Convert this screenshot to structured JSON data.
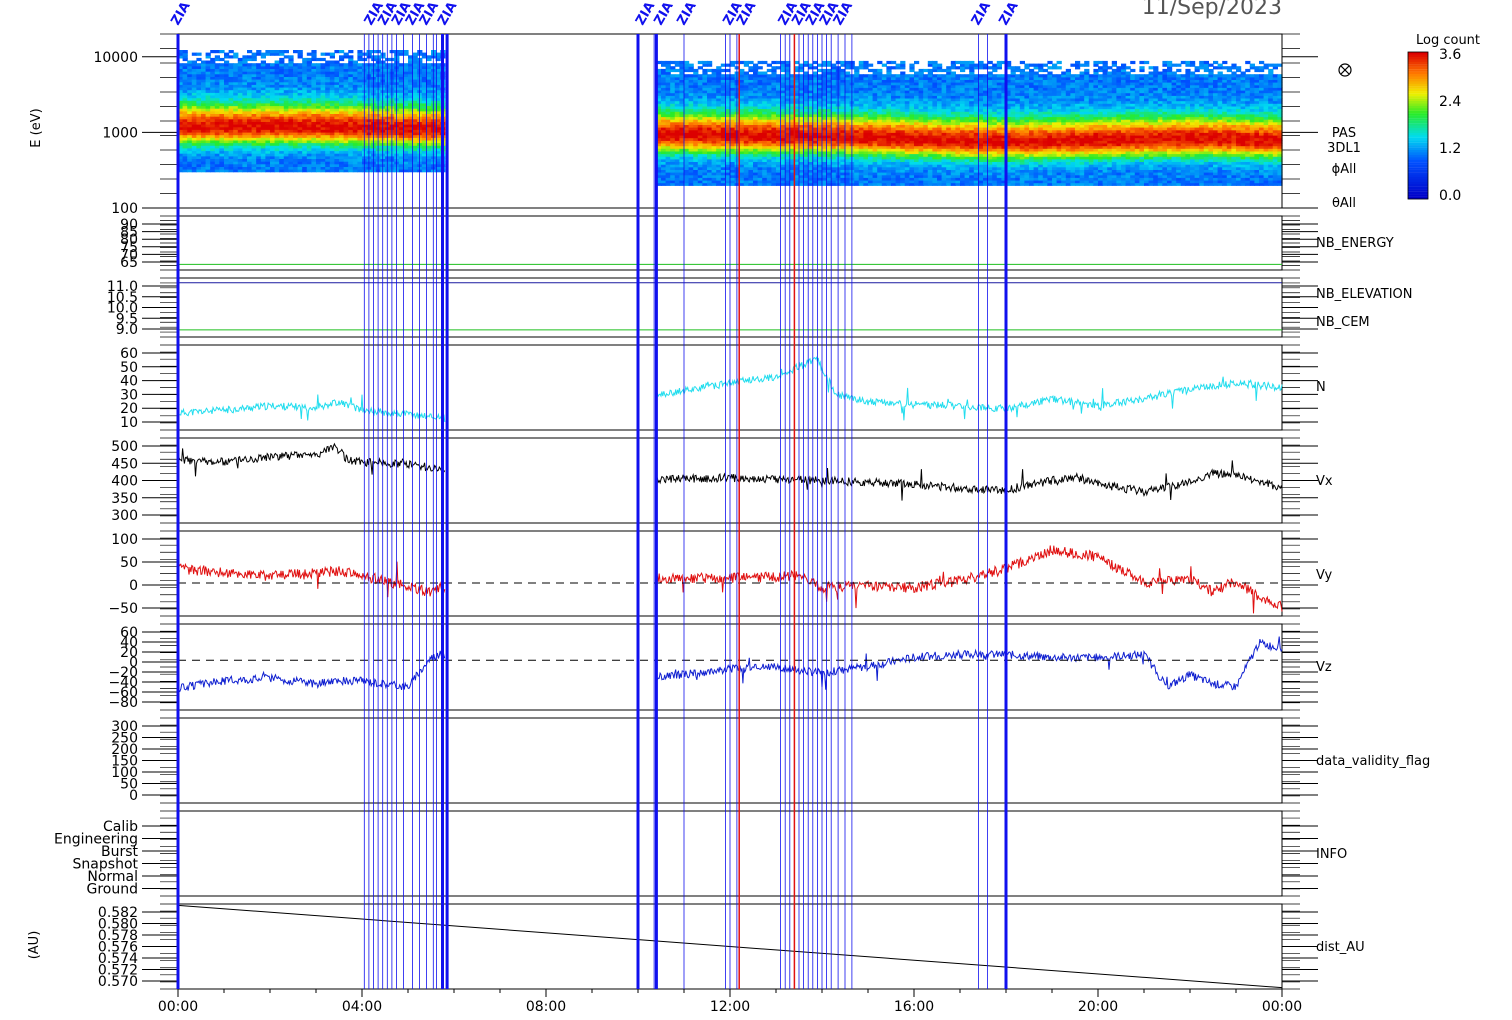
{
  "date_title": "11/Sep/2023",
  "colorbar": {
    "title": "Log count",
    "ticks": [
      "3.6",
      "2.4",
      "1.2",
      "0.0"
    ]
  },
  "marker_label": "ZIA",
  "x_ticks": [
    "00:00",
    "04:00",
    "08:00",
    "12:00",
    "16:00",
    "20:00",
    "00:00"
  ],
  "colors": {
    "nb_energy": "#1fbf1f",
    "nb_elevation": "#1fbf1f",
    "nb_cem": "#1a1aa0",
    "n": "#22ddee",
    "vx": "#000000",
    "vy": "#e01010",
    "vz": "#1020d0",
    "event_blue": "#1010ee",
    "event_red": "#e01010"
  },
  "panels": {
    "energy": {
      "ylabel": "E (eV)",
      "ticks": [
        "10000",
        "1000",
        "100"
      ],
      "right": [
        "PAS",
        "3DL1",
        "ϕAll",
        "θAll"
      ],
      "symbol_icon": "circled-times-icon"
    },
    "nb_energy": {
      "ticks": [
        "90",
        "85",
        "80",
        "75",
        "70",
        "65"
      ],
      "label": "NB_ENERGY"
    },
    "nb_elev": {
      "ticks": [
        "11.0",
        "10.5",
        "10.0",
        "9.5",
        "9.0"
      ],
      "label1": "NB_ELEVATION",
      "label2": "NB_CEM"
    },
    "n": {
      "ticks": [
        "60",
        "50",
        "40",
        "30",
        "20",
        "10"
      ],
      "label": "N"
    },
    "vx": {
      "ticks": [
        "500",
        "450",
        "400",
        "350",
        "300"
      ],
      "label": "Vx"
    },
    "vy": {
      "ticks": [
        "100",
        "50",
        "0",
        "−50"
      ],
      "label": "Vy"
    },
    "vz": {
      "ticks": [
        "60",
        "40",
        "20",
        "0",
        "−20",
        "−40",
        "−60",
        "−80"
      ],
      "label": "Vz"
    },
    "flag": {
      "ticks": [
        "300",
        "250",
        "200",
        "150",
        "100",
        "50",
        "0"
      ],
      "label": "data_validity_flag"
    },
    "info": {
      "ticks": [
        "Calib",
        "Engineering",
        "Burst",
        "Snapshot",
        "Normal",
        "Ground"
      ],
      "label": "INFO"
    },
    "dist": {
      "ylabel": "(AU)",
      "ticks": [
        "0.582",
        "0.580",
        "0.578",
        "0.576",
        "0.574",
        "0.572",
        "0.570"
      ],
      "label": "dist_AU"
    }
  },
  "chart_data": [
    {
      "type": "heatmap",
      "title": "PAS 3DL1",
      "ylabel": "E (eV)",
      "yscale": "log",
      "ylim": [
        100,
        20000
      ],
      "xlim": [
        0,
        24
      ],
      "colorbar_range": [
        0.0,
        3.6
      ],
      "data_gap_hours": [
        5.8,
        10.4
      ],
      "peak_energy_ev": [
        [
          0,
          1150
        ],
        [
          3,
          1150
        ],
        [
          5.7,
          1050
        ],
        [
          10.4,
          900
        ],
        [
          14,
          850
        ],
        [
          18,
          720
        ],
        [
          22,
          800
        ],
        [
          24,
          750
        ]
      ]
    },
    {
      "type": "line",
      "name": "NB_ENERGY",
      "ylim": [
        63,
        92
      ],
      "x": [
        0,
        24
      ],
      "y": [
        66,
        66
      ]
    },
    {
      "type": "line",
      "series": [
        {
          "name": "NB_ELEVATION",
          "x": [
            0,
            24
          ],
          "y": [
            9.0,
            9.0
          ]
        },
        {
          "name": "NB_CEM",
          "x": [
            0,
            24
          ],
          "y": [
            11.0,
            11.0
          ]
        }
      ],
      "ylim": [
        8.7,
        11.2
      ]
    },
    {
      "type": "line",
      "name": "N",
      "ylim": [
        0,
        60
      ],
      "x": [
        0,
        1,
        2,
        3,
        3.5,
        4,
        5,
        5.7,
        10.4,
        11,
        12,
        12.5,
        13,
        13.5,
        13.9,
        14.3,
        15,
        16,
        17,
        18,
        19,
        20,
        21,
        22,
        23,
        24
      ],
      "y": [
        12,
        14,
        17,
        16,
        20,
        14,
        11,
        9,
        24,
        28,
        33,
        36,
        37,
        45,
        50,
        25,
        20,
        18,
        17,
        15,
        22,
        17,
        22,
        29,
        33,
        30
      ]
    },
    {
      "type": "line",
      "name": "Vx",
      "ylim": [
        290,
        520
      ],
      "x": [
        0,
        1,
        2,
        3,
        3.4,
        3.7,
        4,
        5,
        5.7,
        10.4,
        12,
        14,
        16,
        17,
        18,
        19,
        19.5,
        20,
        21,
        22,
        22.5,
        23,
        24
      ],
      "y": [
        460,
        455,
        470,
        475,
        500,
        460,
        455,
        450,
        435,
        408,
        412,
        405,
        395,
        385,
        378,
        405,
        415,
        395,
        375,
        400,
        425,
        420,
        385
      ]
    },
    {
      "type": "line",
      "name": "Vy",
      "ylim": [
        -70,
        110
      ],
      "x": [
        0,
        2,
        3.5,
        4.5,
        5.5,
        5.7,
        10.4,
        12,
        13.5,
        14,
        15,
        16,
        17,
        18,
        19,
        20,
        21,
        22,
        22.5,
        23,
        23.5,
        24
      ],
      "y": [
        30,
        15,
        25,
        5,
        -20,
        -10,
        10,
        10,
        15,
        -10,
        -5,
        -10,
        5,
        30,
        70,
        55,
        0,
        10,
        -20,
        5,
        -30,
        -50
      ]
    },
    {
      "type": "line",
      "name": "Vz",
      "ylim": [
        -85,
        62
      ],
      "x": [
        0,
        1,
        2,
        3,
        3.5,
        4,
        5,
        5.5,
        5.7,
        10.4,
        12,
        13,
        14,
        15,
        16,
        17,
        18,
        19,
        20,
        21,
        21.5,
        22,
        22.5,
        23,
        23.5,
        24
      ],
      "y": [
        -48,
        -35,
        -30,
        -40,
        -35,
        -35,
        -45,
        5,
        10,
        -30,
        -15,
        -12,
        -22,
        -10,
        5,
        10,
        10,
        5,
        5,
        10,
        -45,
        -25,
        -40,
        -45,
        30,
        20
      ]
    },
    {
      "type": "line",
      "name": "data_validity_flag",
      "ylim": [
        0,
        310
      ],
      "x": [],
      "y": []
    },
    {
      "type": "line",
      "name": "INFO",
      "categories": [
        "Calib",
        "Engineering",
        "Burst",
        "Snapshot",
        "Normal",
        "Ground"
      ],
      "x": [],
      "y": []
    },
    {
      "type": "line",
      "name": "dist_AU",
      "ylabel": "(AU)",
      "ylim": [
        0.5696,
        0.5822
      ],
      "x": [
        0,
        24
      ],
      "y": [
        0.582,
        0.5698
      ]
    },
    {
      "type": "line",
      "name": "event_markers_hours",
      "thick_blue": [
        0.0,
        5.75,
        5.85,
        10.0,
        10.4,
        18.0
      ],
      "thin_blue": [
        4.05,
        4.15,
        4.25,
        4.35,
        4.45,
        4.55,
        4.65,
        4.75,
        4.9,
        5.1,
        5.25,
        5.4,
        5.55,
        5.62,
        10.35,
        11.0,
        11.9,
        12.0,
        12.15,
        13.1,
        13.2,
        13.3,
        13.4,
        13.5,
        13.6,
        13.7,
        13.8,
        13.9,
        14.0,
        14.1,
        14.2,
        14.35,
        14.5,
        14.65,
        17.4,
        17.6
      ],
      "red": [
        12.2,
        13.4
      ]
    }
  ]
}
